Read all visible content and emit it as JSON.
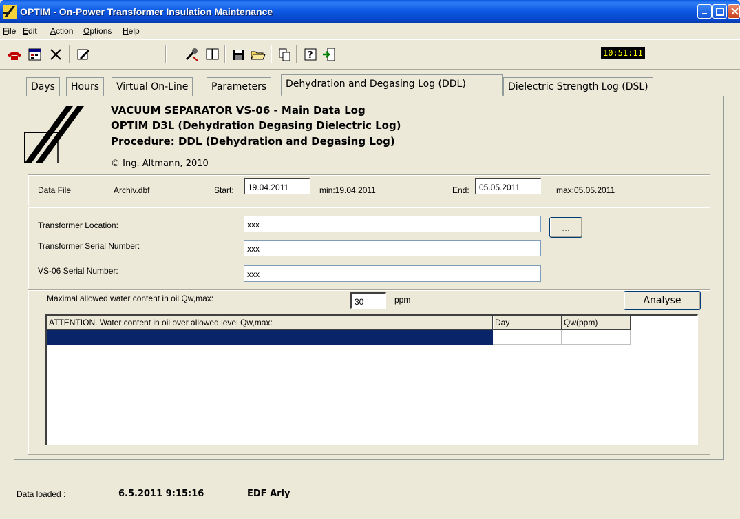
{
  "window": {
    "title": "OPTIM - On-Power Transformer Insulation Maintenance"
  },
  "menu": [
    "File",
    "Edit",
    "Action",
    "Options",
    "Help"
  ],
  "toolbar": {
    "icons": [
      "phone-icon",
      "calendar-icon",
      "delete-icon",
      "edit-icon",
      "tools-icon",
      "book-icon",
      "save-icon",
      "open-folder-icon",
      "copy-icon",
      "help-icon",
      "exit-icon"
    ],
    "clock": "10:51:11"
  },
  "tabs": [
    {
      "label": "Days",
      "active": false
    },
    {
      "label": "Hours",
      "active": false
    },
    {
      "label": "Virtual On-Line",
      "active": false
    },
    {
      "label": "Parameters",
      "active": false
    },
    {
      "label": "Dehydration and Degasing Log (DDL)",
      "active": true
    },
    {
      "label": "Dielectric Strength Log (DSL)",
      "active": false
    }
  ],
  "header": {
    "line1": "VACUUM SEPARATOR VS-06 - Main Data Log",
    "line2": "OPTIM D3L (Dehydration Degasing Dielectric Log)",
    "line3": "Procedure: DDL (Dehydration and Degasing Log)",
    "copyright": "© Ing. Altmann, 2010"
  },
  "datafile": {
    "label": "Data File",
    "name": "Archiv.dbf",
    "start_label": "Start:",
    "start_value": "19.04.2011",
    "min": "min:19.04.2011",
    "end_label": "End:",
    "end_value": "05.05.2011",
    "max": "max:05.05.2011"
  },
  "transformer": {
    "location_label": "Transformer Location:",
    "location_value": "xxx",
    "browse_label": "...",
    "serial_label": "Transformer Serial Number:",
    "serial_value": "xxx",
    "vs_serial_label": "VS-06 Serial Number:",
    "vs_serial_value": "xxx"
  },
  "analysis": {
    "qw_label": "Maximal allowed water content in oil Qw,max:",
    "qw_value": "30",
    "qw_unit": "ppm",
    "analyse_label": "Analyse"
  },
  "grid": {
    "columns": [
      "ATTENTION. Water content in oil over allowed level Qw,max:",
      "Day",
      "Qw(ppm)"
    ]
  },
  "status": {
    "label": "Data loaded :",
    "datetime": "6.5.2011 9:15:16",
    "site": "EDF Arly"
  }
}
